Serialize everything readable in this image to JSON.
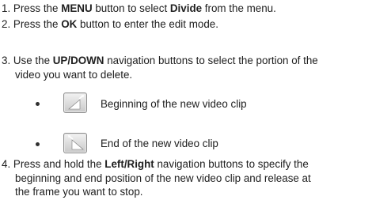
{
  "steps": {
    "step1": {
      "prefix": "1. Press the ",
      "menu_bold": "MENU",
      "mid": " button to select ",
      "divide_bold": "Divide",
      "suffix": " from the menu."
    },
    "step2": {
      "prefix": "2. Press the ",
      "ok_bold": "OK",
      "suffix": " button to enter the edit mode."
    },
    "step3": {
      "prefix": "3. Use the ",
      "updown_bold": "UP/DOWN",
      "line1_suffix": " navigation buttons to select the portion of the",
      "line2": "video you want to delete."
    },
    "bullets": [
      {
        "icon": "clip-start-icon",
        "text": "Beginning of the new video clip"
      },
      {
        "icon": "clip-end-icon",
        "text": "End of the new video clip"
      }
    ],
    "step4": {
      "prefix": "4. Press and hold the ",
      "leftright_bold": "Left/Right",
      "line1_suffix": " navigation buttons to specify the",
      "line2": "beginning and end position of the new video clip and release at",
      "line3": "the frame you want to stop."
    }
  },
  "colors": {
    "text": "#202020",
    "icon_bg_top": "#f2f2f2",
    "icon_bg_bottom": "#c9c9c9",
    "icon_glyph": "#ffffff"
  }
}
